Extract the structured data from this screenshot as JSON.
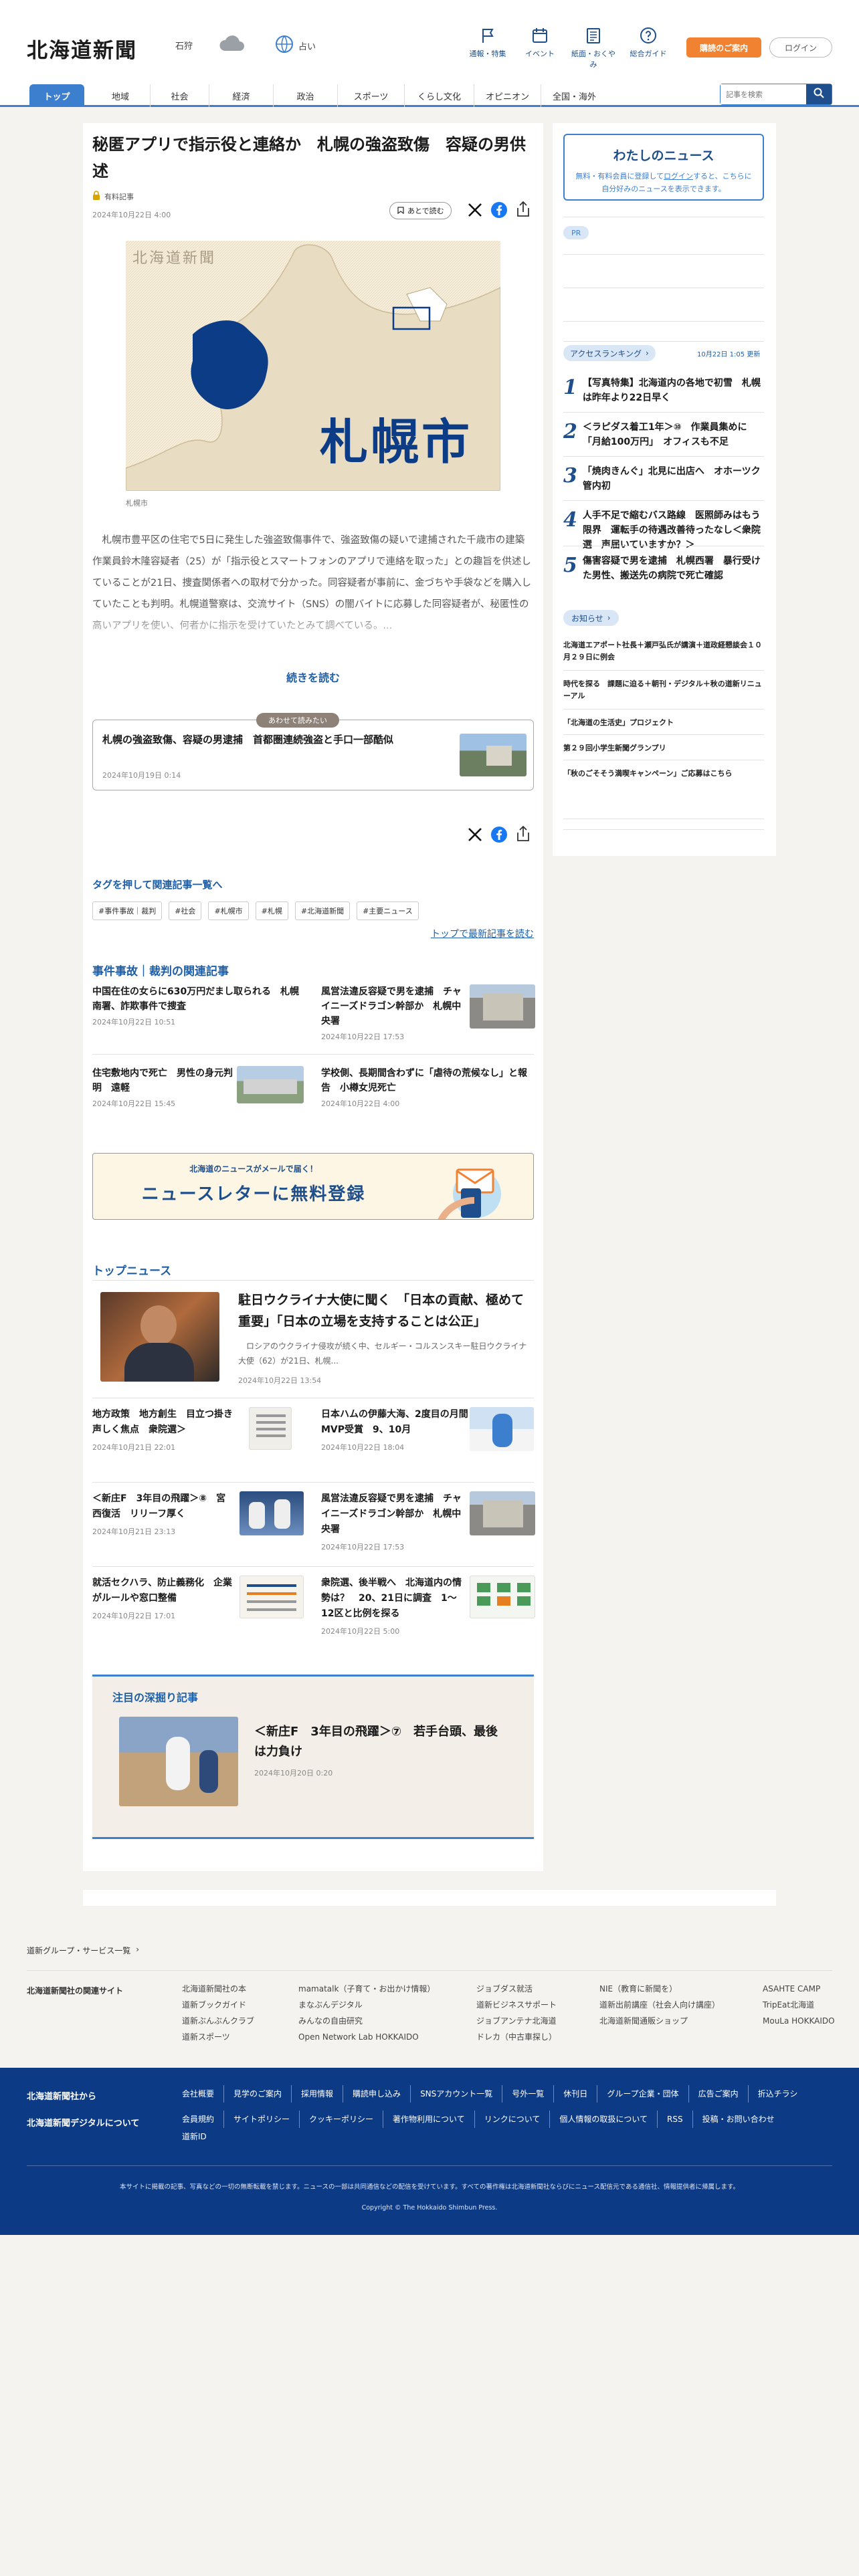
{
  "header": {
    "logo": "北海道新聞",
    "region": "石狩",
    "weather_label": "占い",
    "nav_icons": [
      {
        "label": "通報・特集",
        "icon": "flag-icon"
      },
      {
        "label": "イベント",
        "icon": "calendar-icon"
      },
      {
        "label": "紙面・おくやみ",
        "icon": "newspaper-icon"
      },
      {
        "label": "総合ガイド",
        "icon": "question-icon"
      }
    ],
    "subscribe_label": "購読のご案内",
    "login_label": "ログイン",
    "search_placeholder": "記事を検索"
  },
  "main_nav": [
    "トップ",
    "地域",
    "社会",
    "経済",
    "政治",
    "スポーツ",
    "くらし文化",
    "オピニオン",
    "全国・海外"
  ],
  "article": {
    "title": "秘匿アプリで指示役と連絡か　札幌の強盗致傷　容疑の男供述",
    "badge": "有料記事",
    "date": "2024年10月22日 4:00",
    "save_label": "あとで読む",
    "map_logo": "北海道新聞",
    "map_city": "札幌市",
    "caption": "札幌市",
    "body": "札幌市豊平区の住宅で5日に発生した強盗致傷事件で、強盗致傷の疑いで逮捕された千歳市の建築作業員鈴木隆容疑者（25）が「指示役とスマートフォンのアプリで連絡を取った」との趣旨を供述していることが21日、捜査関係者への取材で分かった。同容疑者が事前に、金づちや手袋などを購入していたことも判明。札幌道警察は、交流サイト（SNS）の闇バイトに応募した同容疑者が、秘匿性の高いアプリを使い、何者かに指示を受けていたとみて調べている。...",
    "read_more": "続きを読む"
  },
  "recommend": {
    "label": "あわせて読みたい",
    "title": "札幌の強盗致傷、容疑の男逮捕　首都圏連続強盗と手口一部酷似",
    "date": "2024年10月19日 0:14"
  },
  "tags": {
    "heading": "タグを押して関連記事一覧へ",
    "items": [
      "#事件事故｜裁判",
      "#社会",
      "#札幌市",
      "#札幌",
      "#北海道新聞",
      "#主要ニュース"
    ],
    "more": "トップで最新記事を読む"
  },
  "related": {
    "heading": "事件事故｜裁判の関連記事",
    "items": [
      {
        "title": "中国在住の女らに630万円だまし取られる　札幌南署、詐欺事件で捜査",
        "date": "2024年10月22日 10:51",
        "thumb": false
      },
      {
        "title": "風営法違反容疑で男を逮捕　チャイニーズドラゴン幹部か　札幌中央署",
        "date": "2024年10月22日 17:53",
        "thumb": true
      },
      {
        "title": "住宅敷地内で死亡　男性の身元判明　遠軽",
        "date": "2024年10月22日 15:45",
        "thumb": true
      },
      {
        "title": "学校側、長期間含わずに「虐待の荒候なし」と報告　小樽女児死亡",
        "date": "2024年10月22日 4:00",
        "thumb": false
      }
    ]
  },
  "newsletter": {
    "line1": "北海道のニュースがメールで届く！",
    "line2": "ニュースレターに無料登録"
  },
  "top_news": {
    "heading": "トップニュース",
    "feature": {
      "title": "駐日ウクライナ大使に聞く　「日本の貢献、極めて重要」「日本の立場を支持することは公正」",
      "desc": "ロシアのウクライナ侵攻が続く中、セルギー・コルスンスキー駐日ウクライナ大使（62）が21日、札幌...",
      "date": "2024年10月22日 13:54"
    },
    "items": [
      {
        "title": "地方政策　地方創生　目立つ掛き声しく焦点　衆院選＞",
        "date": "2024年10月21日 22:01"
      },
      {
        "title": "日本ハムの伊藤大海、2度目の月間MVP受賞　9、10月",
        "date": "2024年10月22日 18:04"
      },
      {
        "title": "＜新庄F　3年目の飛躍＞⑧　宮西復活　リリーフ厚く",
        "date": "2024年10月21日 23:13"
      },
      {
        "title": "風営法違反容疑で男を逮捕　チャイニーズドラゴン幹部か　札幌中央署",
        "date": "2024年10月22日 17:53"
      },
      {
        "title": "就活セクハラ、防止義務化　企業がルールや窓口整備",
        "date": "2024年10月22日 17:01"
      },
      {
        "title": "衆院選、後半戦へ　北海道内の情勢は？　20、21日に調査　1〜12区と比例を探る",
        "date": "2024年10月22日 5:00"
      }
    ]
  },
  "deep": {
    "heading": "注目の深掘り記事",
    "title": "＜新庄F　3年目の飛躍＞⑦　若手台頭、最後は力負け",
    "date": "2024年10月20日 0:20"
  },
  "sidebar": {
    "my_news_title": "わたしのニュース",
    "my_news_text_a": "無料・有料会員に登録して",
    "my_news_login": "ログイン",
    "my_news_text_b": "すると、こちらに自分好みのニュースを表示できます。",
    "pr_label": "PR",
    "ranking_heading": "アクセスランキング",
    "ranking_update": "10月22日 1:05 更新",
    "ranking": [
      {
        "num": "1",
        "title": "【写真特集】北海道内の各地で初雪　札幌は昨年より22日早く"
      },
      {
        "num": "2",
        "title": "＜ラピダス着工1年＞⑩　作業員集めに「月給100万円」　オフィスも不足"
      },
      {
        "num": "3",
        "title": "「焼肉きんぐ」北見に出店へ　オホーツク管内初"
      },
      {
        "num": "4",
        "title": "人手不足で縮むバス路線　医照師みはもう限界　運転手の待遇改善待ったなし＜衆院選　声届いていますか？＞"
      },
      {
        "num": "5",
        "title": "傷害容疑で男を逮捕　札幌西署　暴行受けた男性、搬送先の病院で死亡確認"
      }
    ],
    "notice_heading": "お知らせ",
    "notices": [
      "北海道エアポート社長＋瀬戸弘氏が講演＋道政経懇談会１０月２９日に例会",
      "時代を探る　課題に迫る＋朝刊・デジタル＋秋の道新リニューアル",
      "「北海道の生活史」プロジェクト",
      "第２９回小学生新聞グランプリ",
      "「秋のごそそう満喫キャンペーン」ご応募はこちら"
    ]
  },
  "footer": {
    "group_link": "道新グループ・サービス一覧",
    "related_site_label": "北海道新聞社の関連サイト",
    "sites": [
      [
        "北海道新聞社の本",
        "道新ブックガイド",
        "道新ぶんぶんクラブ",
        "道新スポーツ"
      ],
      [
        "mamatalk（子育て・お出かけ情報）",
        "まなぶんデジタル",
        "みんなの自由研究",
        "Open Network Lab HOKKAIDO"
      ],
      [
        "ジョブダス就活",
        "道新ビジネスサポート",
        "ジョブアンテナ北海道",
        "ドレカ（中古車探し）"
      ],
      [
        "NIE（教育に新聞を）",
        "道新出前講座（社会人向け講座）",
        "北海道新聞通販ショップ"
      ],
      [
        "ASAHTE CAMP",
        "TripEat北海道",
        "MouLa HOKKAIDO"
      ]
    ],
    "company_label": "北海道新聞社から",
    "company_links": [
      "会社概要",
      "見学のご案内",
      "採用情報",
      "購読申し込み",
      "SNSアカウント一覧",
      "号外一覧",
      "休刊日",
      "グループ企業・団体",
      "広告ご案内",
      "折込チラシ"
    ],
    "digital_label": "北海道新聞デジタルについて",
    "digital_links": [
      "会員規約",
      "サイトポリシー",
      "クッキーポリシー",
      "著作物利用について",
      "リンクについて",
      "個人情報の取扱について",
      "RSS",
      "投稿・お問い合わせ",
      "道新ID"
    ],
    "notice": "本サイトに掲載の記事、写真などの一切の無断転載を禁じます。ニュースの一部は共同通信などの配信を受けています。すべての著作権は北海道新聞社ならびにニュース配信元である通信社、情報提供者に帰属します。",
    "copyright": "Copyright © The Hokkaido Shimbun Press."
  }
}
